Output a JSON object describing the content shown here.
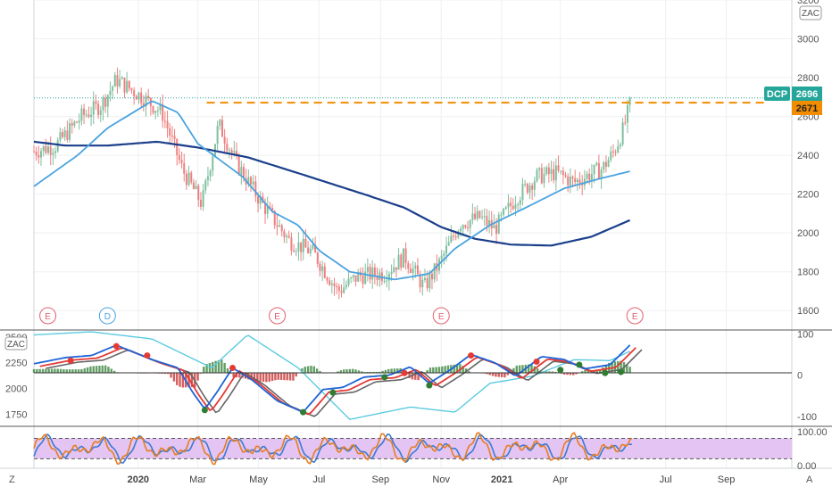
{
  "symbol": "DCP",
  "price_label": "2696",
  "level_label": "2671",
  "currency_badge": "ZAC",
  "corner_left": "Z",
  "corner_right": "A",
  "events": [
    {
      "x": "2019-10-02",
      "text": "E",
      "color": "#e06070"
    },
    {
      "x": "2019-12-01",
      "text": "D",
      "color": "#4aa3df"
    },
    {
      "x": "2020-05-20",
      "text": "E",
      "color": "#e06070"
    },
    {
      "x": "2020-11-01",
      "text": "E",
      "color": "#e06070"
    },
    {
      "x": "2021-05-15",
      "text": "E",
      "color": "#e06070"
    }
  ],
  "colors": {
    "up": "#7fbf9f",
    "down": "#ef7f7f",
    "ma_fast": "#4aa3df",
    "ma_slow": "#1b3f8b",
    "level": "#f28c00",
    "badge": "#26a69a",
    "osc_fast": "#1e63d6",
    "osc_slow": "#e53935",
    "osc_gray": "#666666",
    "osc_band": "#5ccbe0",
    "hist_up": "#2e7d32",
    "hist_down": "#c62828",
    "stoch_fill": "#e4c4f2",
    "stoch_k": "#e67e22",
    "stoch_d": "#3a7bd5"
  },
  "chart_data": [
    {
      "type": "candlestick",
      "xlim": [
        "2019-09-18",
        "2021-10-20"
      ],
      "ylim": [
        1500,
        3200
      ],
      "x_ticks": [
        {
          "x": "2020-01-01",
          "label": "2020",
          "bold": true
        },
        {
          "x": "2020-03-01",
          "label": "Mar"
        },
        {
          "x": "2020-05-01",
          "label": "May"
        },
        {
          "x": "2020-07-01",
          "label": "Jul"
        },
        {
          "x": "2020-09-01",
          "label": "Sep"
        },
        {
          "x": "2020-11-01",
          "label": "Nov"
        },
        {
          "x": "2021-01-01",
          "label": "2021",
          "bold": true
        },
        {
          "x": "2021-03-01",
          "label": "Apr"
        },
        {
          "x": "2021-06-15",
          "label": "Jul"
        },
        {
          "x": "2021-08-15",
          "label": "Sep"
        }
      ],
      "y_ticks": [
        1600,
        1800,
        2000,
        2200,
        2400,
        2600,
        2800,
        3000,
        3200
      ],
      "last_price": 2696,
      "resistance_level": 2671,
      "resistance_from": "2020-03-10",
      "anchors": [
        {
          "x": "2019-09-18",
          "y": 2420
        },
        {
          "x": "2019-10-10",
          "y": 2450
        },
        {
          "x": "2019-11-05",
          "y": 2600
        },
        {
          "x": "2019-11-25",
          "y": 2660
        },
        {
          "x": "2019-12-10",
          "y": 2790
        },
        {
          "x": "2020-01-05",
          "y": 2700
        },
        {
          "x": "2020-01-25",
          "y": 2620
        },
        {
          "x": "2020-02-15",
          "y": 2320
        },
        {
          "x": "2020-03-05",
          "y": 2150
        },
        {
          "x": "2020-03-22",
          "y": 2560
        },
        {
          "x": "2020-04-10",
          "y": 2350
        },
        {
          "x": "2020-05-05",
          "y": 2150
        },
        {
          "x": "2020-06-01",
          "y": 1960
        },
        {
          "x": "2020-06-25",
          "y": 1900
        },
        {
          "x": "2020-07-20",
          "y": 1700
        },
        {
          "x": "2020-08-10",
          "y": 1780
        },
        {
          "x": "2020-09-05",
          "y": 1790
        },
        {
          "x": "2020-09-25",
          "y": 1880
        },
        {
          "x": "2020-10-15",
          "y": 1720
        },
        {
          "x": "2020-10-31",
          "y": 1850
        },
        {
          "x": "2020-11-20",
          "y": 2050
        },
        {
          "x": "2020-12-10",
          "y": 2080
        },
        {
          "x": "2020-12-25",
          "y": 2020
        },
        {
          "x": "2021-01-15",
          "y": 2180
        },
        {
          "x": "2021-02-05",
          "y": 2290
        },
        {
          "x": "2021-02-25",
          "y": 2310
        },
        {
          "x": "2021-03-15",
          "y": 2260
        },
        {
          "x": "2021-03-30",
          "y": 2300
        },
        {
          "x": "2021-04-12",
          "y": 2330
        },
        {
          "x": "2021-04-24",
          "y": 2420
        },
        {
          "x": "2021-05-03",
          "y": 2530
        },
        {
          "x": "2021-05-12",
          "y": 2696
        }
      ],
      "ma_fast_anchors": [
        {
          "x": "2019-09-18",
          "y": 2240
        },
        {
          "x": "2019-11-01",
          "y": 2400
        },
        {
          "x": "2019-12-01",
          "y": 2540
        },
        {
          "x": "2020-01-15",
          "y": 2680
        },
        {
          "x": "2020-02-10",
          "y": 2620
        },
        {
          "x": "2020-03-01",
          "y": 2460
        },
        {
          "x": "2020-04-15",
          "y": 2290
        },
        {
          "x": "2020-05-15",
          "y": 2110
        },
        {
          "x": "2020-06-10",
          "y": 2040
        },
        {
          "x": "2020-07-01",
          "y": 1910
        },
        {
          "x": "2020-08-01",
          "y": 1800
        },
        {
          "x": "2020-09-15",
          "y": 1760
        },
        {
          "x": "2020-10-20",
          "y": 1790
        },
        {
          "x": "2020-11-15",
          "y": 1920
        },
        {
          "x": "2020-12-20",
          "y": 2040
        },
        {
          "x": "2021-01-25",
          "y": 2130
        },
        {
          "x": "2021-03-05",
          "y": 2230
        },
        {
          "x": "2021-04-10",
          "y": 2280
        },
        {
          "x": "2021-05-12",
          "y": 2320
        }
      ],
      "ma_slow_anchors": [
        {
          "x": "2019-09-18",
          "y": 2470
        },
        {
          "x": "2019-10-20",
          "y": 2450
        },
        {
          "x": "2019-12-01",
          "y": 2450
        },
        {
          "x": "2020-01-20",
          "y": 2470
        },
        {
          "x": "2020-03-01",
          "y": 2440
        },
        {
          "x": "2020-04-20",
          "y": 2390
        },
        {
          "x": "2020-06-15",
          "y": 2300
        },
        {
          "x": "2020-08-15",
          "y": 2200
        },
        {
          "x": "2020-09-25",
          "y": 2130
        },
        {
          "x": "2020-11-01",
          "y": 2030
        },
        {
          "x": "2020-12-05",
          "y": 1970
        },
        {
          "x": "2021-01-10",
          "y": 1940
        },
        {
          "x": "2021-02-20",
          "y": 1935
        },
        {
          "x": "2021-04-01",
          "y": 1980
        },
        {
          "x": "2021-05-12",
          "y": 2070
        }
      ]
    },
    {
      "type": "oscillator",
      "left_ticks": [
        1750,
        2000,
        2250,
        2500
      ],
      "left_ylim": [
        1650,
        2550
      ],
      "right_ticks": [
        -100,
        0,
        100
      ],
      "right_ylim": [
        -120,
        105
      ],
      "fast_anchors": [
        {
          "x": "2019-09-18",
          "y": 2240
        },
        {
          "x": "2019-10-20",
          "y": 2300
        },
        {
          "x": "2019-11-15",
          "y": 2320
        },
        {
          "x": "2019-12-10",
          "y": 2420
        },
        {
          "x": "2020-01-15",
          "y": 2280
        },
        {
          "x": "2020-02-10",
          "y": 2200
        },
        {
          "x": "2020-02-25",
          "y": 1960
        },
        {
          "x": "2020-03-08",
          "y": 1800
        },
        {
          "x": "2020-03-20",
          "y": 1960
        },
        {
          "x": "2020-04-05",
          "y": 2200
        },
        {
          "x": "2020-04-25",
          "y": 2080
        },
        {
          "x": "2020-05-20",
          "y": 1880
        },
        {
          "x": "2020-06-15",
          "y": 1770
        },
        {
          "x": "2020-07-05",
          "y": 1990
        },
        {
          "x": "2020-07-25",
          "y": 2010
        },
        {
          "x": "2020-08-15",
          "y": 2110
        },
        {
          "x": "2020-09-10",
          "y": 2130
        },
        {
          "x": "2020-10-01",
          "y": 2210
        },
        {
          "x": "2020-10-20",
          "y": 2050
        },
        {
          "x": "2020-11-10",
          "y": 2180
        },
        {
          "x": "2020-12-01",
          "y": 2330
        },
        {
          "x": "2020-12-25",
          "y": 2250
        },
        {
          "x": "2021-01-15",
          "y": 2120
        },
        {
          "x": "2021-02-10",
          "y": 2310
        },
        {
          "x": "2021-03-05",
          "y": 2280
        },
        {
          "x": "2021-03-25",
          "y": 2190
        },
        {
          "x": "2021-04-20",
          "y": 2230
        },
        {
          "x": "2021-05-12",
          "y": 2440
        }
      ],
      "band_anchors": [
        {
          "x": "2019-09-18",
          "y": 2520
        },
        {
          "x": "2019-11-15",
          "y": 2550
        },
        {
          "x": "2020-01-15",
          "y": 2480
        },
        {
          "x": "2020-03-15",
          "y": 2200
        },
        {
          "x": "2020-04-20",
          "y": 2520
        },
        {
          "x": "2020-06-10",
          "y": 2200
        },
        {
          "x": "2020-08-01",
          "y": 1700
        },
        {
          "x": "2020-10-01",
          "y": 1820
        },
        {
          "x": "2020-11-15",
          "y": 1770
        },
        {
          "x": "2020-12-20",
          "y": 2050
        },
        {
          "x": "2021-02-01",
          "y": 2120
        },
        {
          "x": "2021-03-15",
          "y": 2280
        },
        {
          "x": "2021-04-20",
          "y": 2270
        },
        {
          "x": "2021-05-12",
          "y": 2370
        }
      ],
      "markers": [
        {
          "x": "2019-10-25",
          "y": 2270,
          "kind": "red"
        },
        {
          "x": "2019-12-10",
          "y": 2410,
          "kind": "red"
        },
        {
          "x": "2020-01-10",
          "y": 2320,
          "kind": "red"
        },
        {
          "x": "2020-03-08",
          "y": 1790,
          "kind": "green"
        },
        {
          "x": "2020-04-05",
          "y": 2200,
          "kind": "red"
        },
        {
          "x": "2020-06-15",
          "y": 1770,
          "kind": "green"
        },
        {
          "x": "2020-07-15",
          "y": 1960,
          "kind": "green"
        },
        {
          "x": "2020-09-05",
          "y": 2110,
          "kind": "green"
        },
        {
          "x": "2020-09-25",
          "y": 2150,
          "kind": "red"
        },
        {
          "x": "2020-10-20",
          "y": 2030,
          "kind": "green"
        },
        {
          "x": "2020-12-01",
          "y": 2320,
          "kind": "red"
        },
        {
          "x": "2021-02-05",
          "y": 2260,
          "kind": "red"
        },
        {
          "x": "2021-03-01",
          "y": 2180,
          "kind": "green"
        },
        {
          "x": "2021-03-20",
          "y": 2230,
          "kind": "green"
        },
        {
          "x": "2021-04-15",
          "y": 2150,
          "kind": "green"
        },
        {
          "x": "2021-05-01",
          "y": 2160,
          "kind": "green"
        }
      ]
    },
    {
      "type": "line",
      "ylim": [
        0,
        110
      ],
      "y_ticks": [
        {
          "value": 0,
          "label": "0.00"
        },
        {
          "value": 100,
          "label": "100.00"
        }
      ],
      "band": [
        20,
        80
      ],
      "series": [
        {
          "values_from": "stoch_k"
        },
        {
          "values_from": "stoch_d"
        }
      ]
    }
  ]
}
